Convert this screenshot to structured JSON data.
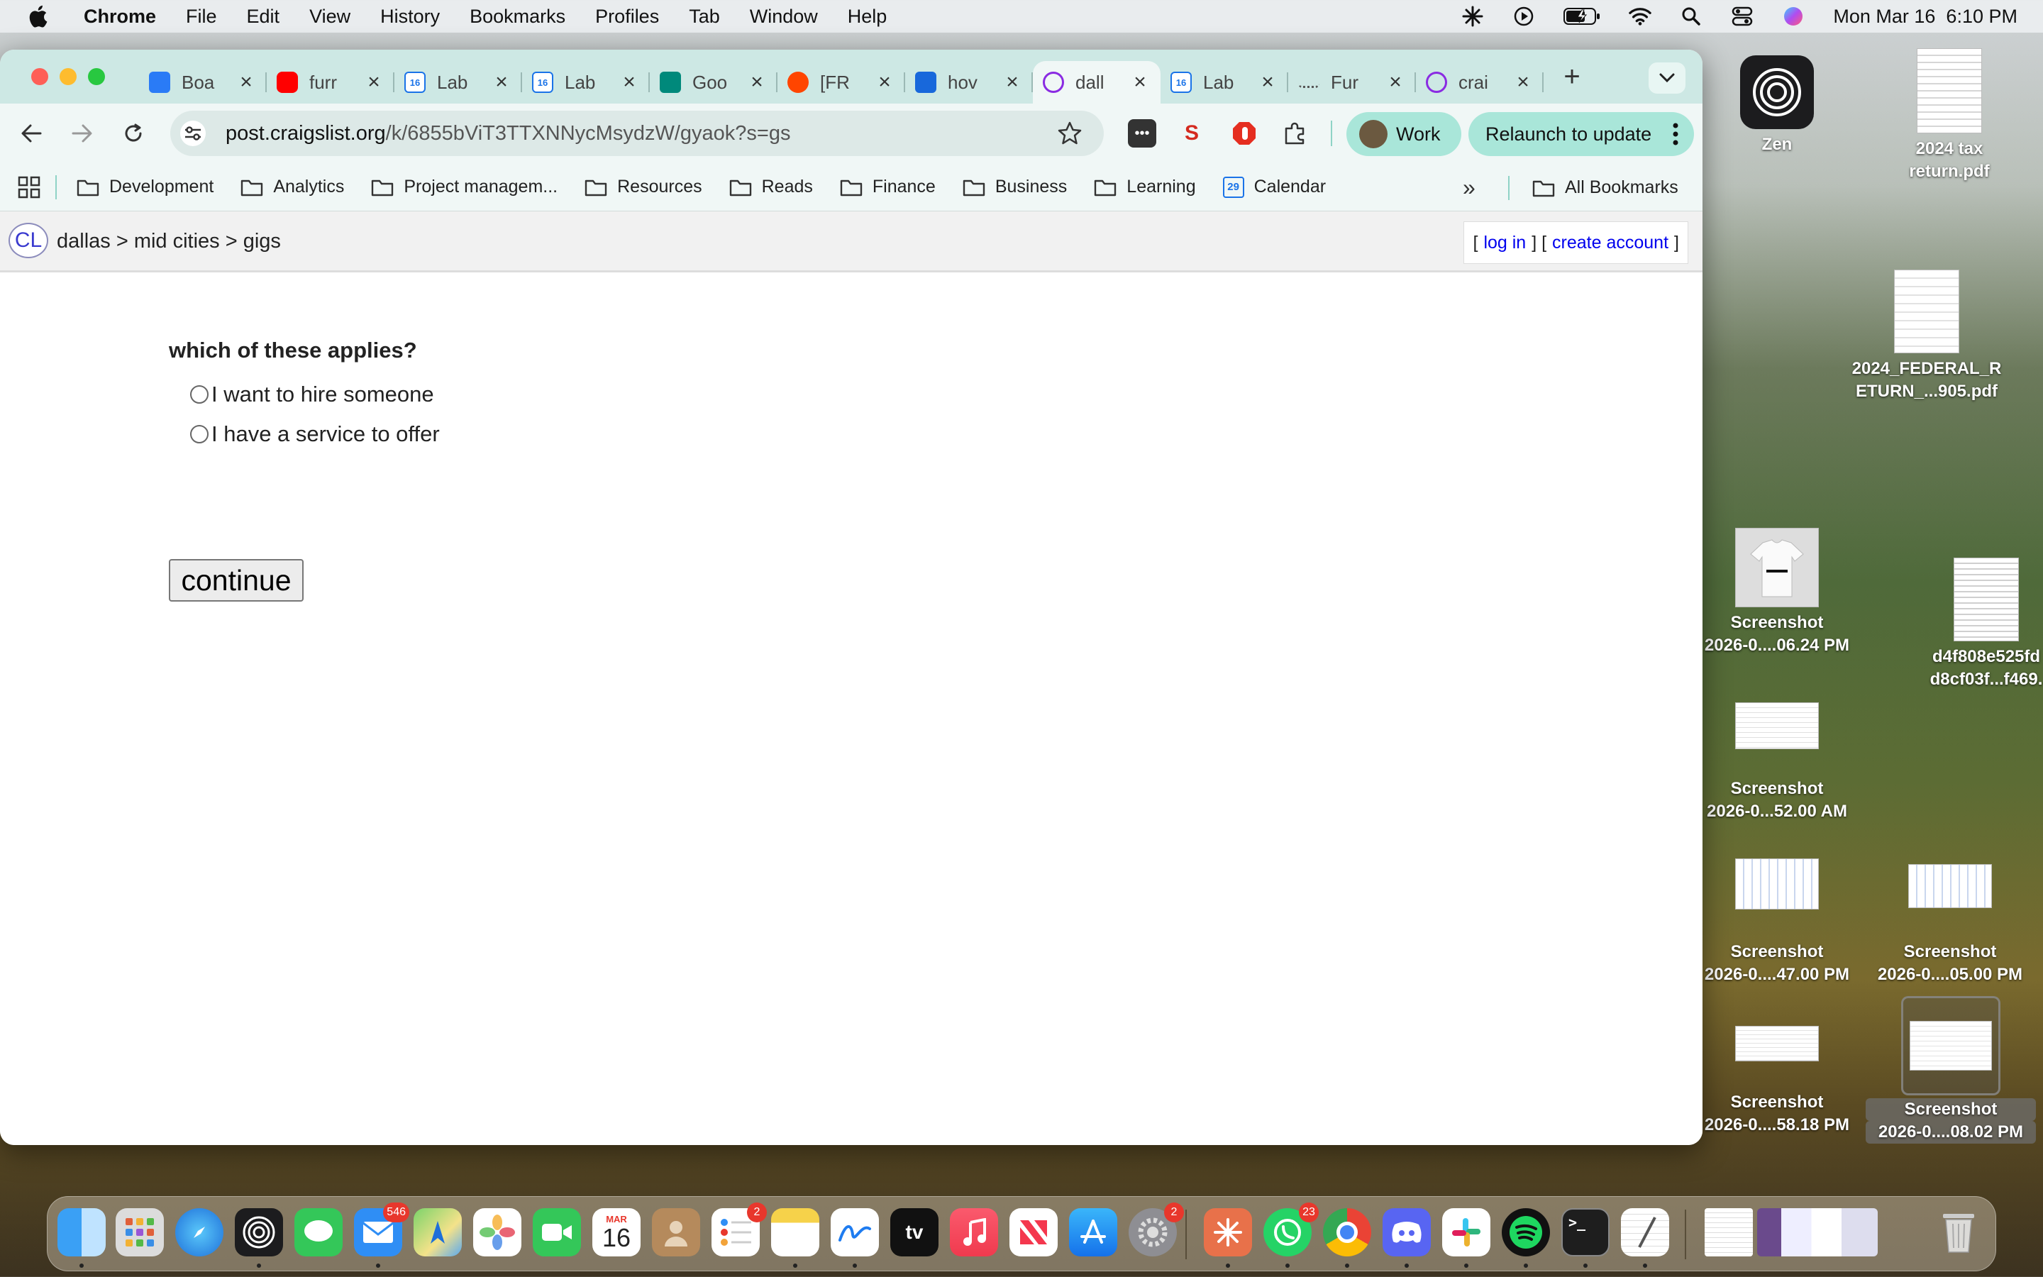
{
  "menubar": {
    "app_name": "Chrome",
    "menus": [
      "File",
      "Edit",
      "View",
      "History",
      "Bookmarks",
      "Profiles",
      "Tab",
      "Window",
      "Help"
    ],
    "datetime": "Mon Mar 16  6:10 PM"
  },
  "tabs": [
    {
      "title": "Boa",
      "icon": "jira-icon",
      "color": "#2a7bf6"
    },
    {
      "title": "furr",
      "icon": "youtube-icon",
      "color": "#ff0000"
    },
    {
      "title": "Lab",
      "icon": "calendar-icon",
      "color": "#1a73e8"
    },
    {
      "title": "Lab",
      "icon": "calendar-icon",
      "color": "#1a73e8"
    },
    {
      "title": "Goo",
      "icon": "google-meet-icon",
      "color": "#00897b"
    },
    {
      "title": "[FR",
      "icon": "reddit-icon",
      "color": "#ff4500"
    },
    {
      "title": "hov",
      "icon": "confluence-icon",
      "color": "#1868db"
    },
    {
      "title": "dall",
      "icon": "craigslist-peace-icon",
      "color": "#8a2be2",
      "active": true
    },
    {
      "title": "Lab",
      "icon": "calendar-icon",
      "color": "#1a73e8"
    },
    {
      "title": "Fur",
      "icon": "dash-icon",
      "color": "#555555"
    },
    {
      "title": "crai",
      "icon": "craigslist-peace-icon",
      "color": "#8a2be2"
    }
  ],
  "toolbar": {
    "url_host": "post.craigslist.org",
    "url_path": "/k/6855bViT3TTXNNycMsydzW/gyaok?s=gs",
    "profile_label": "Work",
    "relaunch_label": "Relaunch to update"
  },
  "bookmarks": {
    "items": [
      "Development",
      "Analytics",
      "Project managem...",
      "Resources",
      "Reads",
      "Finance",
      "Business",
      "Learning"
    ],
    "calendar": "Calendar",
    "calendar_day": "29",
    "all": "All Bookmarks"
  },
  "page": {
    "logo": "CL",
    "breadcrumb": "dallas > mid cities > gigs",
    "account_open": "[",
    "login": "log in",
    "account_mid": "] [",
    "create": "create account",
    "account_close": "]",
    "question": "which of these applies?",
    "options": [
      "I want to hire someone",
      "I have a service to offer"
    ],
    "continue_label": "continue"
  },
  "desktop": [
    {
      "label": "Zen",
      "label2": ""
    },
    {
      "label": "2024 tax",
      "label2": "return.pdf"
    },
    {
      "label": "2024_FEDERAL_R",
      "label2": "ETURN_...905.pdf"
    },
    {
      "label": "Screenshot",
      "label2": "2026-0....06.24 PM"
    },
    {
      "label": "d4f808e525fd",
      "label2": "d8cf03f...f469."
    },
    {
      "label": "Screenshot",
      "label2": "2026-0...52.00 AM"
    },
    {
      "label": "Screenshot",
      "label2": "2026-0....47.00 PM"
    },
    {
      "label": "Screenshot",
      "label2": "2026-0....05.00 PM"
    },
    {
      "label": "Screenshot",
      "label2": "2026-0....58.18 PM"
    },
    {
      "label": "Screenshot",
      "label2": "2026-0....08.02 PM"
    }
  ],
  "dock": {
    "mail_badge": "546",
    "calendar_month": "MAR",
    "calendar_day": "16",
    "reminders_badge": "2",
    "settings_badge": "2",
    "whatsapp_badge": "23",
    "tv_label": "tv"
  }
}
